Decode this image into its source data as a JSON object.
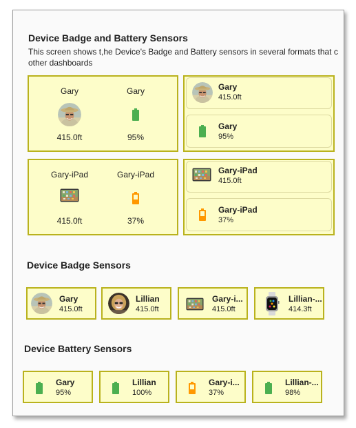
{
  "section1": {
    "title": "Device Badge and Battery Sensors",
    "description_line1": "This screen shows t,he Device's Badge and Battery sensors in several formats that c",
    "description_line2": "other dashboards",
    "gary_vertical": {
      "badge_name": "Gary",
      "badge_value": "415.0ft",
      "battery_name": "Gary",
      "battery_value": "95%"
    },
    "gary_horizontal": {
      "badge_name": "Gary",
      "badge_value": "415.0ft",
      "battery_name": "Gary",
      "battery_value": "95%"
    },
    "ipad_vertical": {
      "badge_name": "Gary-iPad",
      "badge_value": "415.0ft",
      "battery_name": "Gary-iPad",
      "battery_value": "37%"
    },
    "ipad_horizontal": {
      "badge_name": "Gary-iPad",
      "badge_value": "415.0ft",
      "battery_name": "Gary-iPad",
      "battery_value": "37%"
    }
  },
  "section2": {
    "title": "Device Badge Sensors",
    "items": [
      {
        "name": "Gary",
        "value": "415.0ft",
        "icon": "gary-avatar-icon"
      },
      {
        "name": "Lillian",
        "value": "415.0ft",
        "icon": "lillian-avatar-icon"
      },
      {
        "name": "Gary-i...",
        "value": "415.0ft",
        "icon": "ipad-icon"
      },
      {
        "name": "Lillian-...",
        "value": "414.3ft",
        "icon": "watch-icon"
      }
    ]
  },
  "section3": {
    "title": "Device Battery Sensors",
    "items": [
      {
        "name": "Gary",
        "value": "95%",
        "icon": "battery-full-icon"
      },
      {
        "name": "Lillian",
        "value": "100%",
        "icon": "battery-full-icon"
      },
      {
        "name": "Gary-i...",
        "value": "37%",
        "icon": "battery-low-icon"
      },
      {
        "name": "Lillian-...",
        "value": "98%",
        "icon": "battery-full-icon"
      }
    ]
  },
  "colors": {
    "card_bg": "#fdfdc9",
    "card_border": "#b9b21d",
    "battery_green": "#4caf50",
    "battery_orange": "#ff9800"
  }
}
